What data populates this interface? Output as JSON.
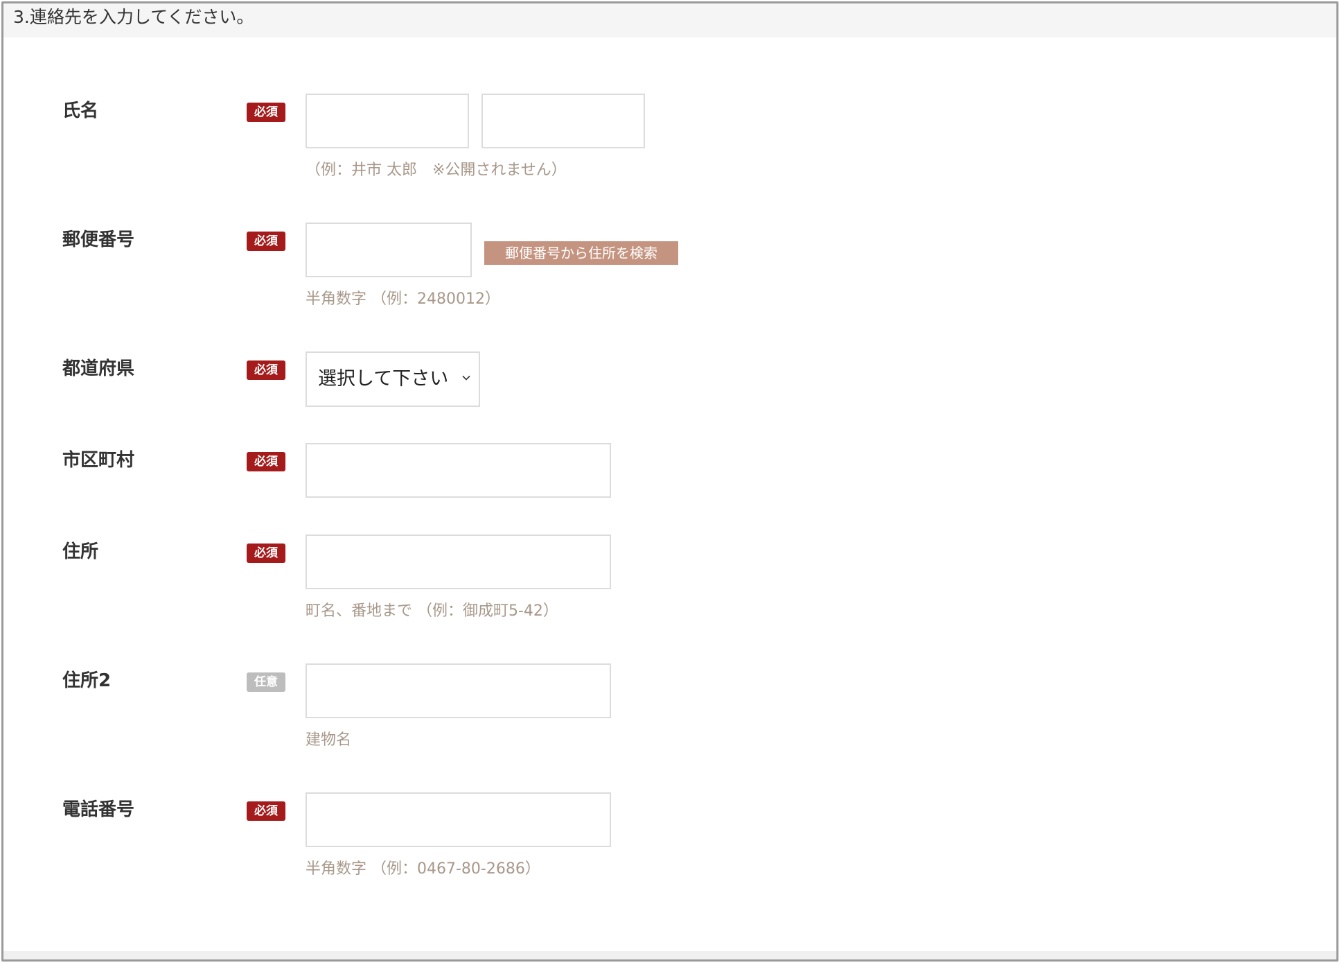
{
  "section": {
    "title": "3.連絡先を入力してください。"
  },
  "badges": {
    "required": "必須",
    "optional": "任意"
  },
  "fields": {
    "name": {
      "label": "氏名",
      "hint": "（例：井市 太郎　※公開されません）",
      "last_value": "",
      "first_value": ""
    },
    "postal": {
      "label": "郵便番号",
      "button_label": "郵便番号から住所を検索",
      "hint": "半角数字 （例：2480012）",
      "value": ""
    },
    "prefecture": {
      "label": "都道府県",
      "selected": "選択して下さい"
    },
    "city": {
      "label": "市区町村",
      "value": ""
    },
    "address": {
      "label": "住所",
      "hint": "町名、番地まで （例：御成町5-42）",
      "value": ""
    },
    "address2": {
      "label": "住所2",
      "hint": "建物名",
      "value": ""
    },
    "phone": {
      "label": "電話番号",
      "hint": "半角数字 （例：0467-80-2686）",
      "value": ""
    }
  },
  "colors": {
    "required_badge": "#a51b1b",
    "optional_badge": "#bdbdbd",
    "search_button": "#c49480",
    "hint_text": "#a8988a"
  },
  "icons": {
    "select_arrow": "chevron-down-icon"
  }
}
